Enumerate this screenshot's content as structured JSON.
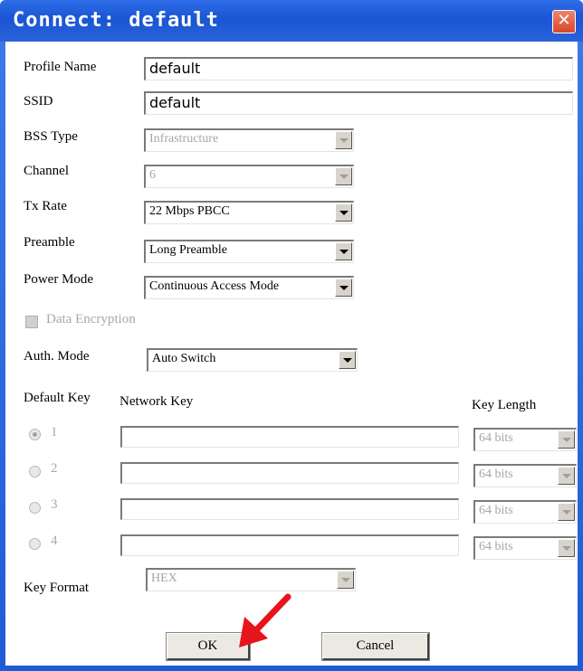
{
  "window": {
    "title": "Connect: default",
    "close_symbol": "✕"
  },
  "fields": {
    "profile_name": {
      "label": "Profile Name",
      "value": "default"
    },
    "ssid": {
      "label": "SSID",
      "value": "default"
    },
    "bss_type": {
      "label": "BSS Type",
      "value": "Infrastructure",
      "enabled": false
    },
    "channel": {
      "label": "Channel",
      "value": "6",
      "enabled": false
    },
    "tx_rate": {
      "label": "Tx Rate",
      "value": "22 Mbps PBCC"
    },
    "preamble": {
      "label": "Preamble",
      "value": "Long Preamble"
    },
    "power_mode": {
      "label": "Power Mode",
      "value": "Continuous Access Mode"
    },
    "data_encryption": {
      "label": "Data Encryption",
      "checked": false,
      "enabled": false
    },
    "auth_mode": {
      "label": "Auth. Mode",
      "value": "Auto Switch"
    }
  },
  "keys": {
    "default_key_label": "Default Key",
    "network_key_label": "Network Key",
    "key_length_label": "Key Length",
    "rows": [
      {
        "index": "1",
        "selected": true,
        "network_key": "",
        "key_length": "64 bits"
      },
      {
        "index": "2",
        "selected": false,
        "network_key": "",
        "key_length": "64 bits"
      },
      {
        "index": "3",
        "selected": false,
        "network_key": "",
        "key_length": "64 bits"
      },
      {
        "index": "4",
        "selected": false,
        "network_key": "",
        "key_length": "64 bits"
      }
    ],
    "key_format": {
      "label": "Key Format",
      "value": "HEX",
      "enabled": false
    }
  },
  "buttons": {
    "ok": "OK",
    "cancel": "Cancel"
  },
  "annotation": {
    "pointer": "red-arrow-icon",
    "color": "#e8141c"
  },
  "colors": {
    "titlebar": "#1f5bd6",
    "close": "#d9462a",
    "disabled_text": "#a8a8a8"
  }
}
